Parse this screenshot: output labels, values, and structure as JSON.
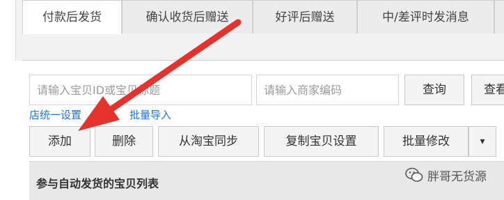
{
  "tabs": [
    {
      "label": "付款后发货",
      "active": true
    },
    {
      "label": "确认收货后赠送",
      "active": false
    },
    {
      "label": "好评后赠送",
      "active": false
    },
    {
      "label": "中/差评时发消息",
      "active": false
    }
  ],
  "search": {
    "item_placeholder": "请输入宝贝ID或宝贝标题",
    "merchant_placeholder": "请输入商家编码",
    "query_label": "查询",
    "view_label": "查看"
  },
  "links": {
    "store_settings": "店统一设置",
    "batch_import": "批量导入"
  },
  "toolbar": {
    "add_label": "添加",
    "delete_label": "删除",
    "sync_label": "从淘宝同步",
    "copy_label": "复制宝贝设置",
    "batch_edit_label": "批量修改",
    "dropdown_glyph": "▾"
  },
  "list": {
    "title": "参与自动发货的宝贝列表"
  },
  "watermark": {
    "text": "胖哥无货源"
  },
  "colors": {
    "arrow": "#e5322d",
    "link": "#1e73d0"
  }
}
